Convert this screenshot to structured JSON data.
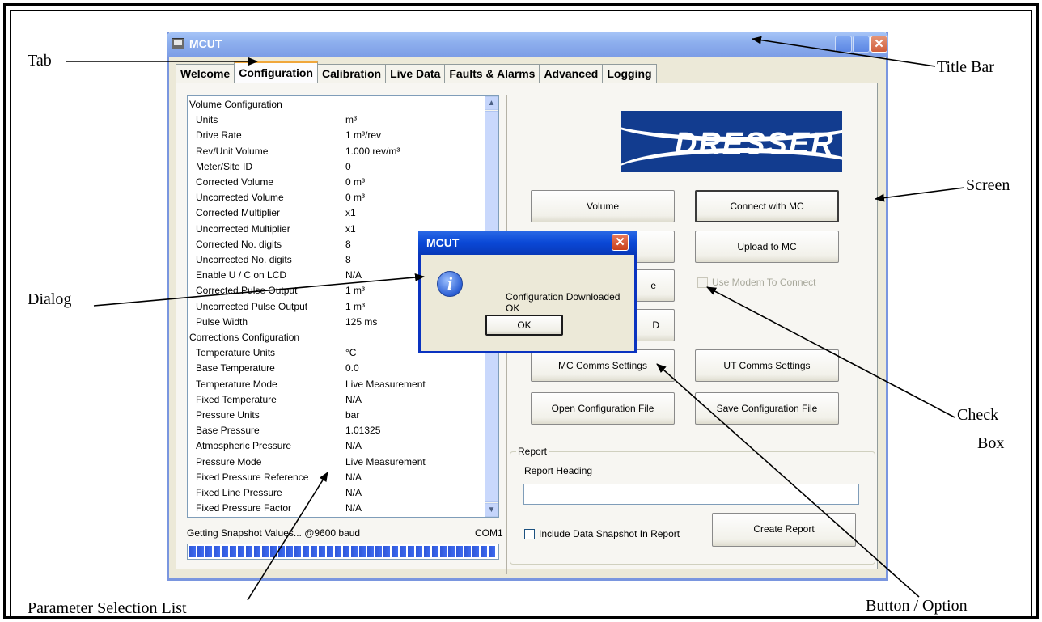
{
  "annotations": {
    "tab": "Tab",
    "title_bar": "Title Bar",
    "screen": "Screen",
    "dialog": "Dialog",
    "check_box_line1": "Check",
    "check_box_line2": "Box",
    "parameter_list": "Parameter Selection List",
    "button_option": "Button / Option"
  },
  "window": {
    "title": "MCUT",
    "close_glyph": "✕"
  },
  "tabs": [
    {
      "label": "Welcome"
    },
    {
      "label": "Configuration",
      "active": true
    },
    {
      "label": "Calibration"
    },
    {
      "label": "Live Data"
    },
    {
      "label": "Faults & Alarms"
    },
    {
      "label": "Advanced"
    },
    {
      "label": "Logging"
    }
  ],
  "parameters": [
    {
      "name": "Volume Configuration",
      "value": "",
      "header": true
    },
    {
      "name": "Units",
      "value": "m³"
    },
    {
      "name": "Drive Rate",
      "value": "1 m³/rev"
    },
    {
      "name": "Rev/Unit Volume",
      "value": "1.000 rev/m³"
    },
    {
      "name": "Meter/Site ID",
      "value": "0"
    },
    {
      "name": "Corrected Volume",
      "value": "0 m³"
    },
    {
      "name": "Uncorrected Volume",
      "value": "0 m³"
    },
    {
      "name": "Corrected Multiplier",
      "value": "x1"
    },
    {
      "name": "Uncorrected Multiplier",
      "value": "x1"
    },
    {
      "name": "Corrected No. digits",
      "value": "8"
    },
    {
      "name": "Uncorrected No. digits",
      "value": "8"
    },
    {
      "name": "Enable U / C on LCD",
      "value": "N/A"
    },
    {
      "name": "Corrected Pulse Output",
      "value": "1 m³"
    },
    {
      "name": "Uncorrected Pulse Output",
      "value": "1 m³"
    },
    {
      "name": "Pulse Width",
      "value": "125 ms"
    },
    {
      "name": "Corrections Configuration",
      "value": "",
      "header": true
    },
    {
      "name": "Temperature Units",
      "value": "°C"
    },
    {
      "name": "Base Temperature",
      "value": "0.0"
    },
    {
      "name": "Temperature Mode",
      "value": "Live Measurement"
    },
    {
      "name": "Fixed Temperature",
      "value": "N/A"
    },
    {
      "name": "Pressure Units",
      "value": "bar"
    },
    {
      "name": "Base Pressure",
      "value": "1.01325"
    },
    {
      "name": "Atmospheric Pressure",
      "value": "N/A"
    },
    {
      "name": "Pressure Mode",
      "value": "Live Measurement"
    },
    {
      "name": "Fixed Pressure Reference",
      "value": "N/A"
    },
    {
      "name": "Fixed Line Pressure",
      "value": "N/A"
    },
    {
      "name": "Fixed Pressure Factor",
      "value": "N/A"
    }
  ],
  "status": {
    "text": "Getting Snapshot Values... @9600 baud",
    "port": "COM1",
    "progress": 1.0
  },
  "logo": {
    "text": "DRESSER"
  },
  "buttons": {
    "volume": "Volume",
    "connect": "Connect with MC",
    "upload": "Upload to MC",
    "partial_3": "e",
    "partial_4": "D",
    "mc_comms": "MC Comms Settings",
    "ut_comms": "UT Comms Settings",
    "open_config": "Open Configuration File",
    "save_config": "Save Configuration File",
    "create_report": "Create Report"
  },
  "checkboxes": {
    "use_modem": {
      "label": "Use Modem To Connect",
      "checked": false,
      "disabled": true
    },
    "include_snapshot": {
      "label": "Include Data Snapshot In Report",
      "checked": false
    }
  },
  "report": {
    "legend": "Report",
    "heading_label": "Report Heading",
    "heading_value": ""
  },
  "dialog": {
    "title": "MCUT",
    "close_glyph": "✕",
    "icon_glyph": "i",
    "message": "Configuration Downloaded OK",
    "ok_label": "OK"
  }
}
